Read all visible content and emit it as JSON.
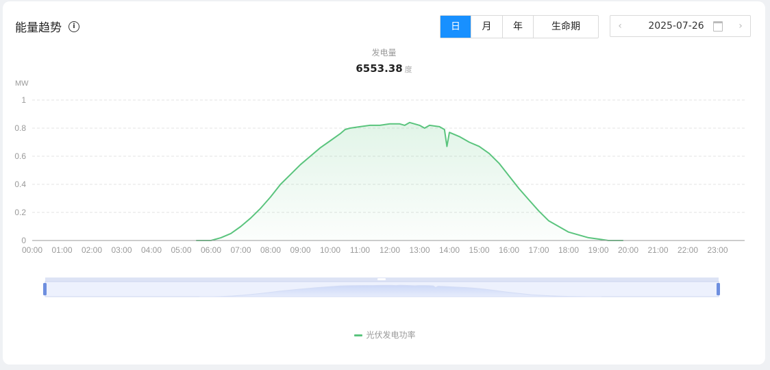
{
  "header": {
    "title": "能量趋势"
  },
  "period_buttons": [
    "日",
    "月",
    "年",
    "生命期"
  ],
  "period_active_index": 0,
  "date_picker": {
    "value": "2025-07-26"
  },
  "summary": {
    "label": "发电量",
    "value": "6553.38",
    "unit": "度"
  },
  "colors": {
    "accent": "#1890ff",
    "series": "#5ac47d",
    "grid": "#e3e3e3"
  },
  "chart_data": {
    "type": "area",
    "ylabel": "MW",
    "ylim": [
      0,
      1
    ],
    "yticks": [
      "0",
      "0.2",
      "0.4",
      "0.6",
      "0.8",
      "1"
    ],
    "xticks": [
      "00:00",
      "01:00",
      "02:00",
      "03:00",
      "04:00",
      "05:00",
      "06:00",
      "07:00",
      "08:00",
      "09:00",
      "10:00",
      "11:00",
      "12:00",
      "13:00",
      "14:00",
      "15:00",
      "16:00",
      "17:00",
      "18:00",
      "19:00",
      "20:00",
      "21:00",
      "22:00",
      "23:00"
    ],
    "grid": true,
    "legend_position": "bottom-center",
    "series": [
      {
        "name": "光伏发电功率",
        "x": [
          "05:30",
          "06:00",
          "06:20",
          "06:40",
          "07:00",
          "07:20",
          "07:40",
          "08:00",
          "08:20",
          "08:40",
          "09:00",
          "09:20",
          "09:40",
          "10:00",
          "10:20",
          "10:30",
          "10:40",
          "11:00",
          "11:20",
          "11:40",
          "12:00",
          "12:20",
          "12:30",
          "12:40",
          "13:00",
          "13:10",
          "13:20",
          "13:40",
          "13:50",
          "13:55",
          "14:00",
          "14:20",
          "14:30",
          "14:40",
          "15:00",
          "15:20",
          "15:40",
          "16:00",
          "16:20",
          "16:40",
          "17:00",
          "17:20",
          "17:40",
          "18:00",
          "18:20",
          "18:40",
          "19:00",
          "19:20",
          "19:50"
        ],
        "values": [
          0,
          0,
          0.02,
          0.05,
          0.1,
          0.16,
          0.23,
          0.31,
          0.4,
          0.47,
          0.54,
          0.6,
          0.66,
          0.71,
          0.76,
          0.79,
          0.8,
          0.81,
          0.82,
          0.82,
          0.83,
          0.83,
          0.82,
          0.84,
          0.82,
          0.8,
          0.82,
          0.81,
          0.79,
          0.67,
          0.77,
          0.74,
          0.72,
          0.7,
          0.67,
          0.62,
          0.55,
          0.46,
          0.37,
          0.29,
          0.21,
          0.14,
          0.1,
          0.06,
          0.04,
          0.02,
          0.01,
          0,
          0
        ]
      }
    ]
  }
}
